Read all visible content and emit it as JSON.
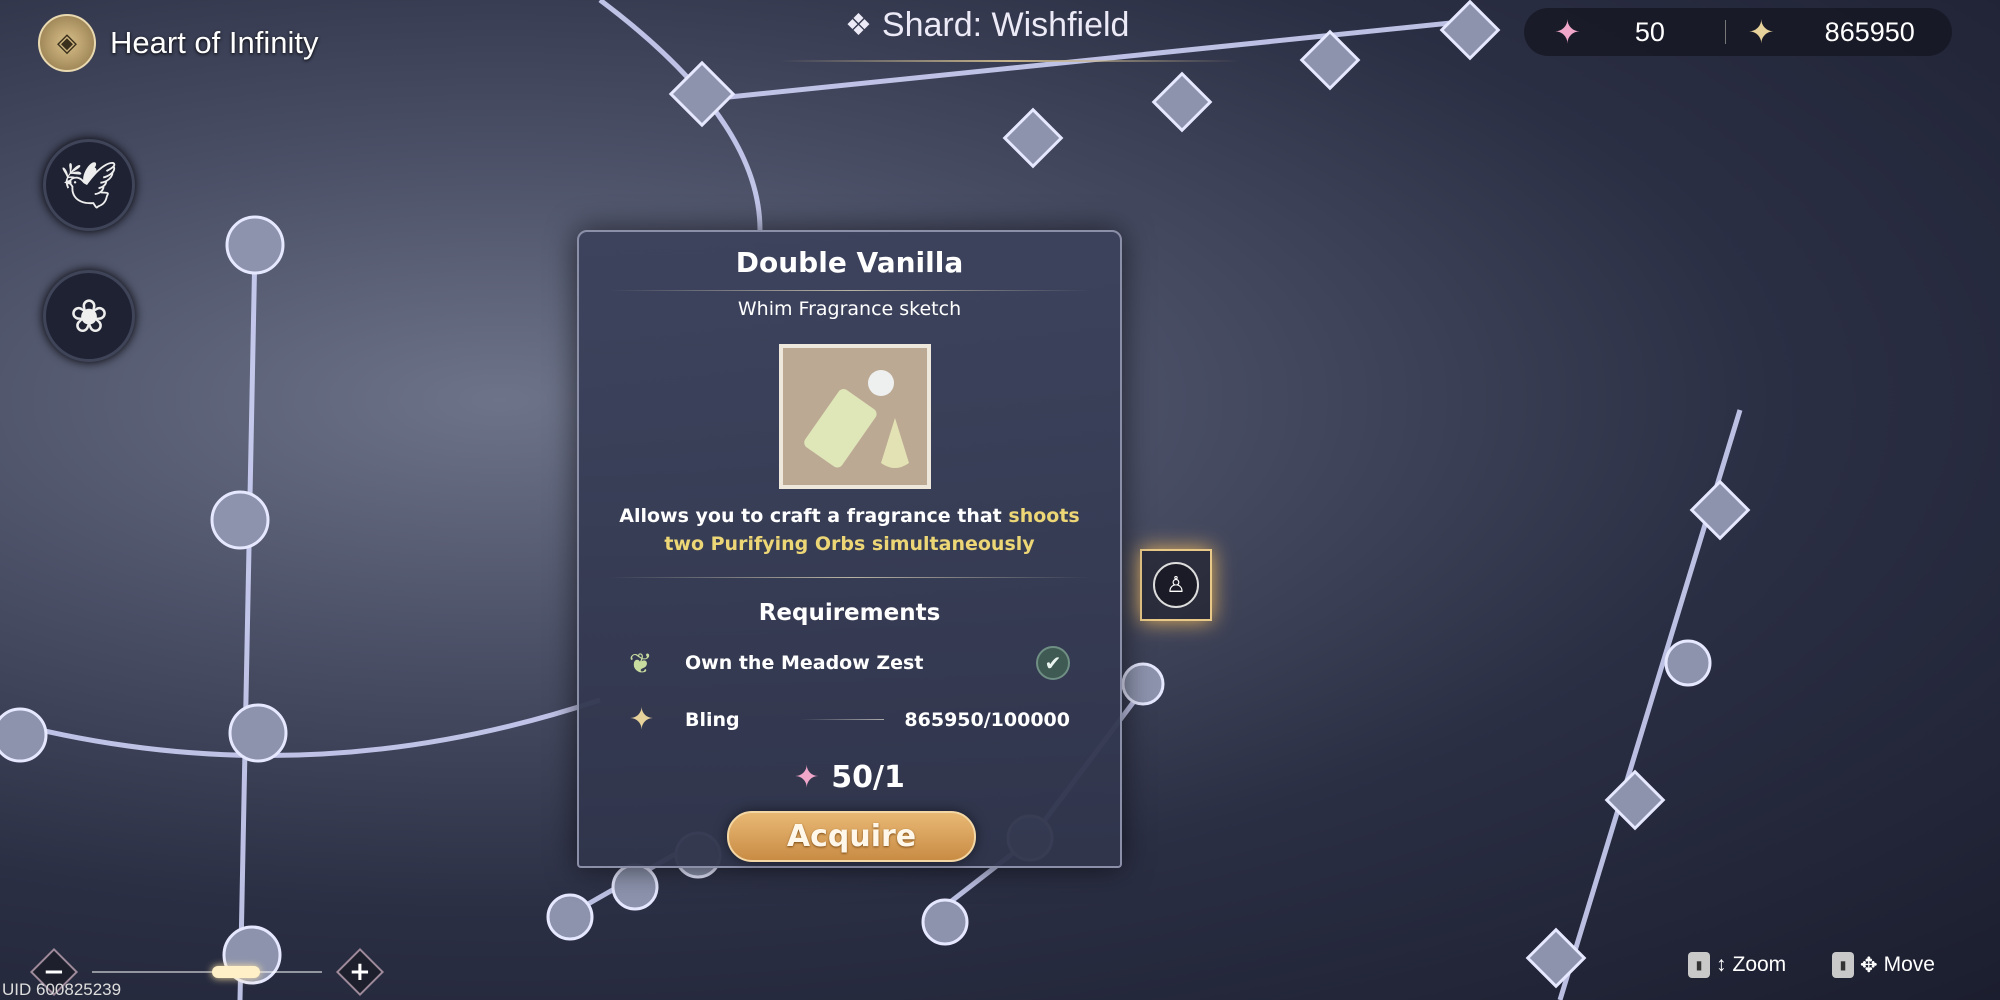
{
  "header": {
    "title": "Heart of Infinity",
    "shard_title": "Shard: Wishfield",
    "stars": "50",
    "bling": "865950"
  },
  "sidebar": {
    "items": [
      {
        "icon": "hummingbird-icon"
      },
      {
        "icon": "rose-icon"
      }
    ]
  },
  "panel": {
    "title": "Double Vanilla",
    "subtitle": "Whim Fragrance sketch",
    "description_plain": "Allows you to craft a fragrance that ",
    "description_highlight": "shoots two Purifying Orbs simultaneously",
    "requirements_heading": "Requirements",
    "requirements": [
      {
        "label": "Own the Meadow Zest",
        "icon": "meadow-zest-icon",
        "status": "complete"
      },
      {
        "label": "Bling",
        "icon": "bling-icon",
        "value": "865950/100000"
      }
    ],
    "cost": "50/1",
    "acquire_label": "Acquire"
  },
  "footer": {
    "uid": "UID 600825239",
    "zoom_minus": "−",
    "zoom_plus": "+",
    "zoom_hint": "Zoom",
    "move_hint": "Move",
    "zoom_level": 0.45
  },
  "colors": {
    "highlight": "#ecd675",
    "acquire": "#d9a25a",
    "panel": "#3c425c"
  }
}
